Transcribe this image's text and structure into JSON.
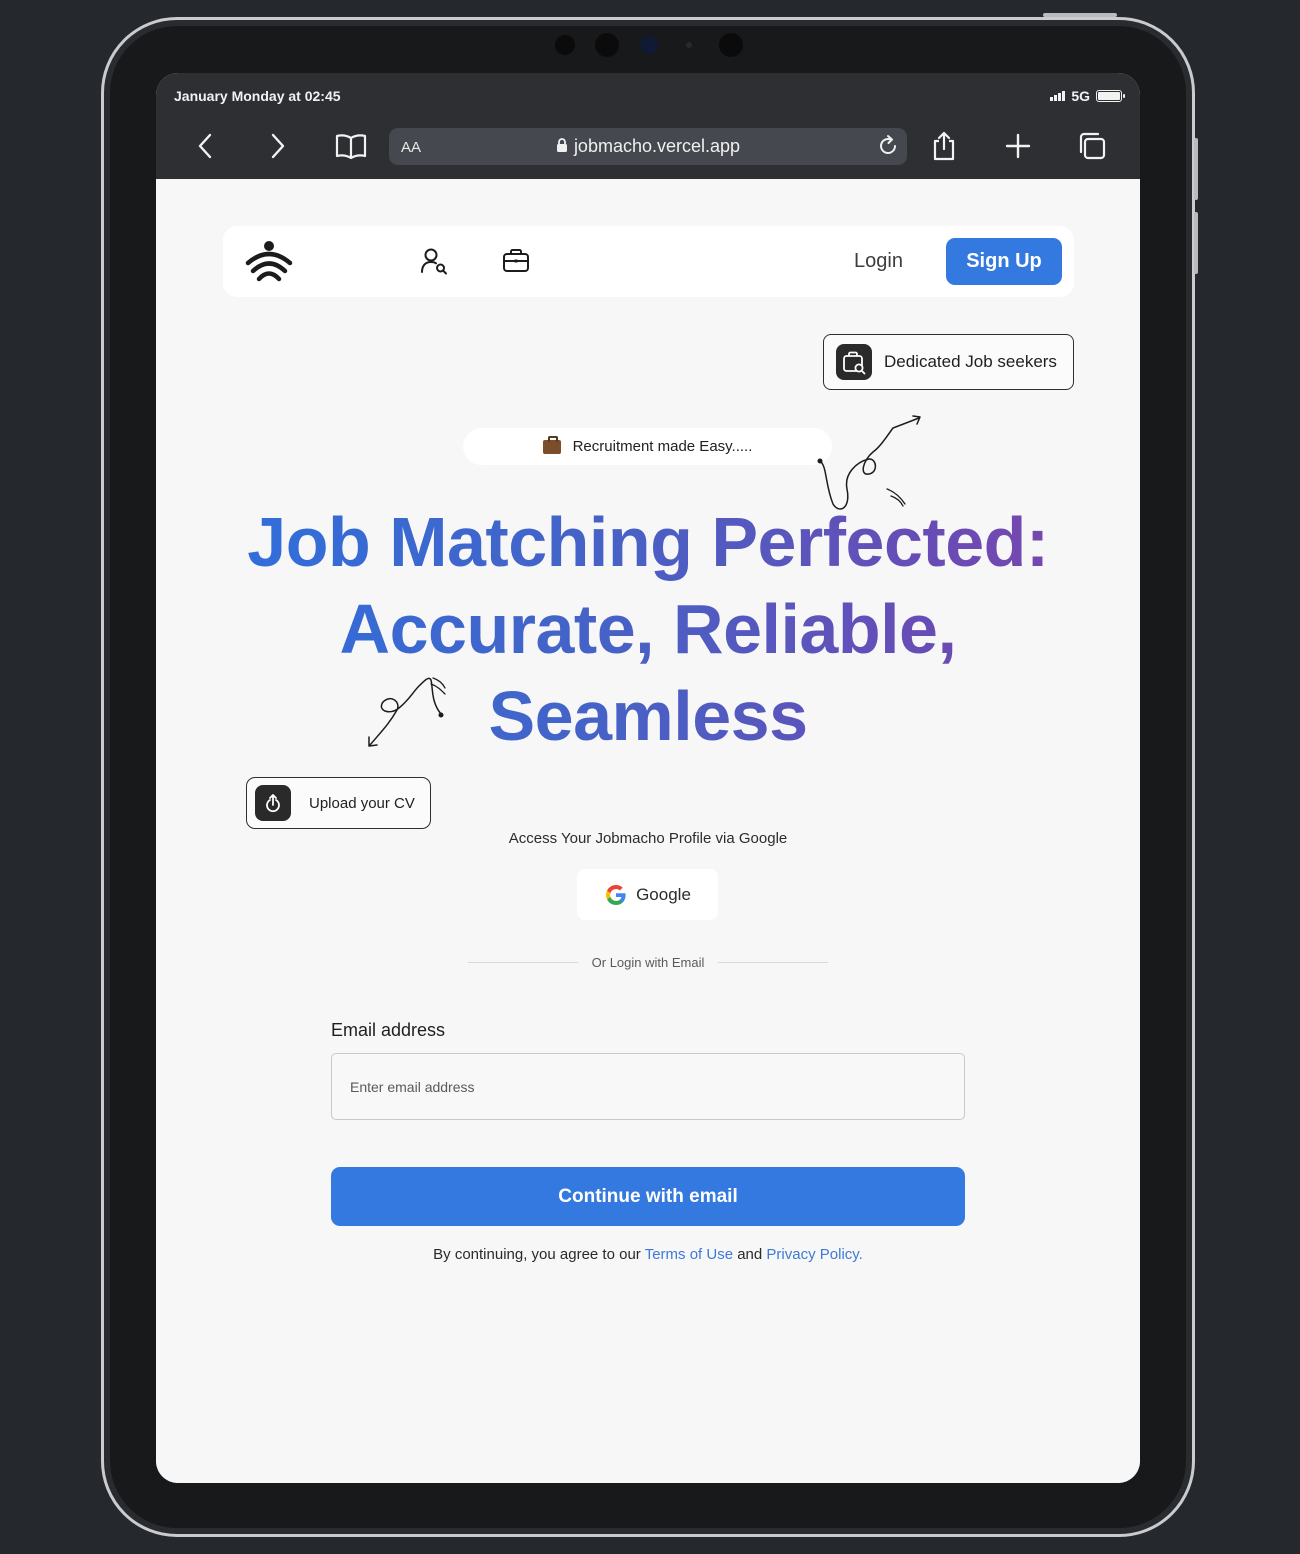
{
  "status_bar": {
    "time": "January Monday at 02:45",
    "network": "5G"
  },
  "browser": {
    "aa_label": "AA",
    "url": "jobmacho.vercel.app",
    "icons": [
      "back-icon",
      "forward-icon",
      "bookmarks-icon",
      "lock-icon",
      "reload-icon",
      "share-icon",
      "new-tab-icon",
      "tabs-icon"
    ]
  },
  "nav": {
    "login_label": "Login",
    "signup_label": "Sign Up",
    "icons": [
      "logo-icon",
      "profile-search-icon",
      "briefcase-icon"
    ]
  },
  "hero": {
    "dedicated_label": "Dedicated Job seekers",
    "recruit_label": "Recruitment made Easy.....",
    "headline_line1": "Job Matching Perfected:",
    "headline_line2": "Accurate, Reliable,",
    "headline_line3": "Seamless",
    "upload_label": "Upload your CV",
    "gradient_colors": [
      "#2f6fdc",
      "#7a47ad"
    ]
  },
  "auth": {
    "access_text": "Access Your Jobmacho Profile via Google",
    "google_label": "Google",
    "divider_text": "Or Login with Email",
    "email_label": "Email address",
    "email_placeholder": "Enter email address",
    "email_value": "",
    "continue_label": "Continue with email",
    "terms_prefix": "By continuing, you agree to our ",
    "terms_link": "Terms of Use",
    "terms_and": " and ",
    "privacy_link": "Privacy Policy."
  },
  "colors": {
    "accent": "#3379e0",
    "link": "#3e7ad6",
    "chrome": "#2d2f33",
    "page_bg": "#f7f7f7"
  }
}
